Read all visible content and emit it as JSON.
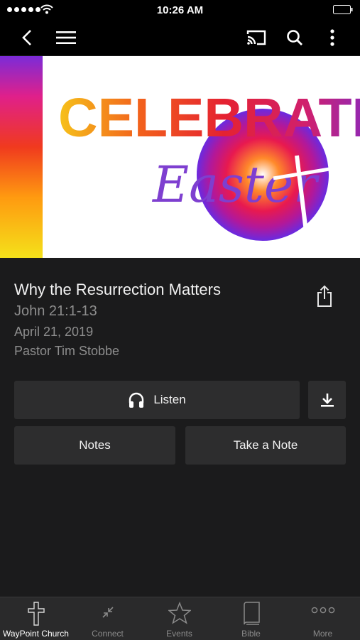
{
  "status": {
    "time": "10:26 AM"
  },
  "nav": {
    "back_icon": "chevron-left-icon",
    "menu_icon": "hamburger-icon",
    "cast_icon": "cast-icon",
    "search_icon": "search-icon",
    "more_icon": "vertical-ellipsis-icon"
  },
  "banner": {
    "headline": "CELEBRATE",
    "script_text": "Easter"
  },
  "sermon": {
    "title": "Why the Resurrection Matters",
    "scripture": "John 21:1-13",
    "date": "April 21, 2019",
    "speaker": "Pastor Tim Stobbe"
  },
  "actions": {
    "listen_label": "Listen",
    "notes_label": "Notes",
    "take_note_label": "Take a Note"
  },
  "tabs": [
    {
      "label": "WayPoint Church",
      "icon": "cross-icon",
      "active": true
    },
    {
      "label": "Connect",
      "icon": "arrows-in-icon",
      "active": false
    },
    {
      "label": "Events",
      "icon": "star-icon",
      "active": false
    },
    {
      "label": "Bible",
      "icon": "book-icon",
      "active": false
    },
    {
      "label": "More",
      "icon": "dots-icon",
      "active": false
    }
  ],
  "colors": {
    "background": "#1b1b1c",
    "button": "#2d2d2e",
    "secondary_text": "#8d8d8d"
  }
}
